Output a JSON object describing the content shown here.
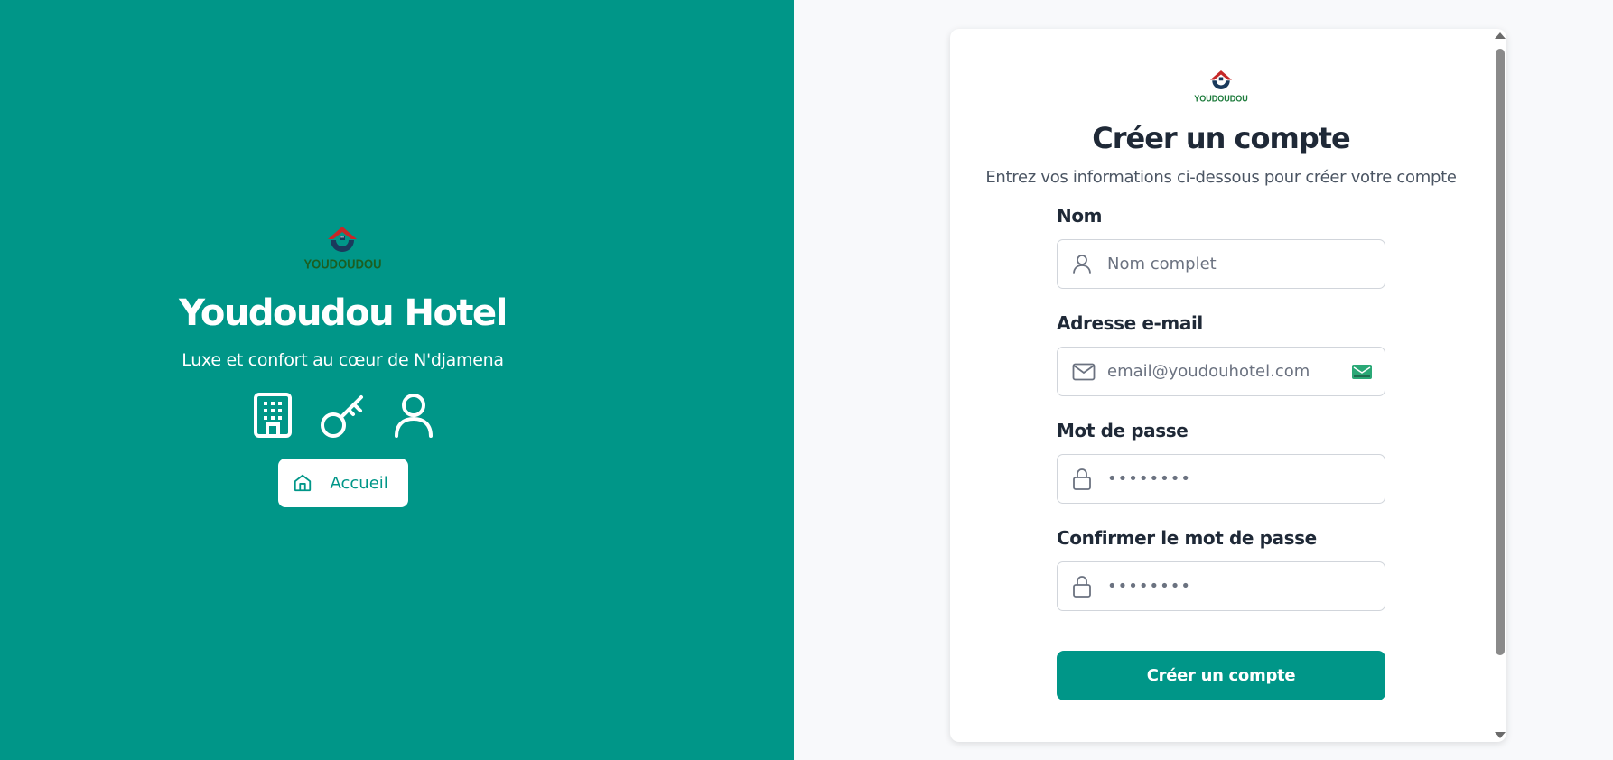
{
  "brand": {
    "logo_text": "YOUDOUDOU",
    "title": "Youdoudou Hotel",
    "subtitle": "Luxe et confort au cœur de N'djamena",
    "feature_icons": [
      "building-icon",
      "key-icon",
      "user-icon"
    ],
    "home_button_label": "Accueil",
    "colors": {
      "primary": "#009688",
      "logo_red": "#c62828",
      "logo_dark": "#1a3a5c",
      "logo_green": "#1b7a3a"
    }
  },
  "form": {
    "logo_text": "YOUDOUDOU",
    "title": "Créer un compte",
    "subtitle": "Entrez vos informations ci-dessous pour créer votre compte",
    "fields": [
      {
        "label": "Nom",
        "placeholder": "Nom complet",
        "icon": "user-icon"
      },
      {
        "label": "Adresse e-mail",
        "placeholder": "email@youdouhotel.com",
        "icon": "mail-icon"
      },
      {
        "label": "Mot de passe",
        "placeholder": "••••••••",
        "icon": "lock-icon"
      },
      {
        "label": "Confirmer le mot de passe",
        "placeholder": "••••••••",
        "icon": "lock-icon"
      }
    ],
    "submit_label": "Créer un compte"
  }
}
